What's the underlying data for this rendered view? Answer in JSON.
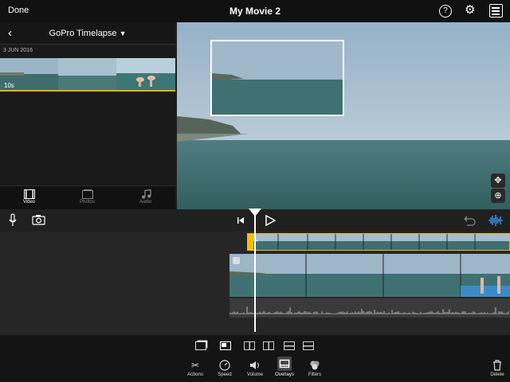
{
  "topbar": {
    "done_label": "Done",
    "title": "My Movie 2"
  },
  "browser": {
    "album_title": "GoPro Timelapse",
    "date": "3 JUN 2016",
    "clip_duration": "10s",
    "tabs": [
      {
        "label": "Video",
        "icon": "film-icon"
      },
      {
        "label": "Photos",
        "icon": "photos-icon"
      },
      {
        "label": "Audio",
        "icon": "music-note-icon"
      }
    ]
  },
  "toolbar": {
    "tools": [
      {
        "label": "Actions",
        "icon": "scissors-icon"
      },
      {
        "label": "Speed",
        "icon": "speedometer-icon"
      },
      {
        "label": "Volume",
        "icon": "speaker-icon"
      },
      {
        "label": "Overlays",
        "icon": "overlays-icon"
      },
      {
        "label": "Filters",
        "icon": "filters-icon"
      }
    ],
    "delete_label": "Delete"
  },
  "colors": {
    "accent": "#f0b400",
    "highlight_blue": "#3aa0ff"
  }
}
